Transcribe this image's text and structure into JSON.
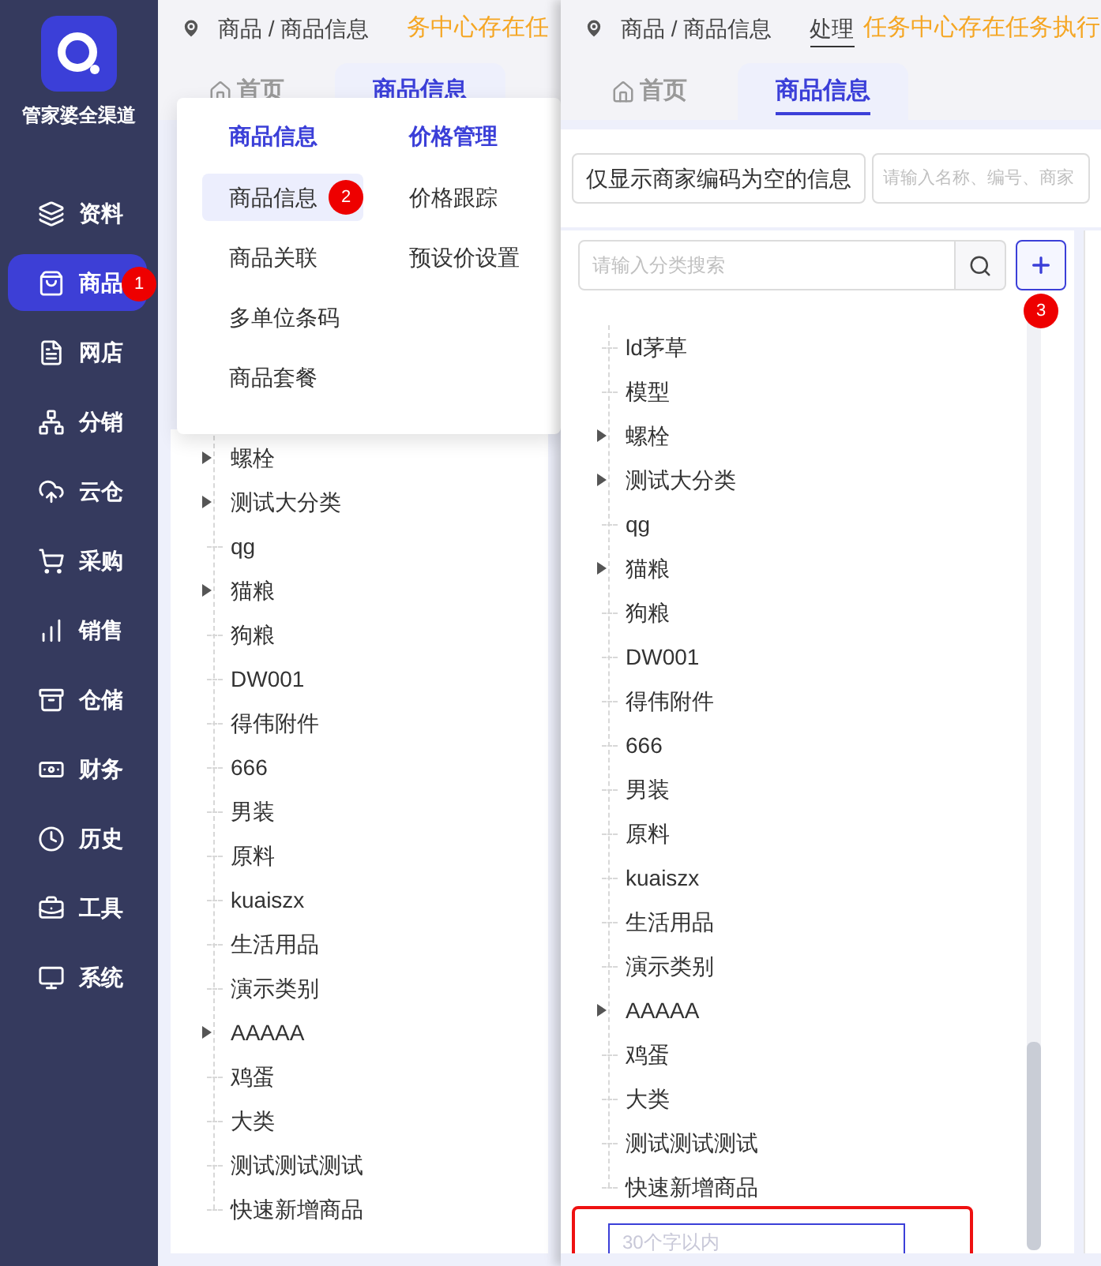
{
  "sidebar": {
    "brand": "管家婆全渠道",
    "items": [
      {
        "label": "资料",
        "selected": false
      },
      {
        "label": "商品",
        "selected": true,
        "badge": "1"
      },
      {
        "label": "网店",
        "selected": false
      },
      {
        "label": "分销",
        "selected": false
      },
      {
        "label": "云仓",
        "selected": false
      },
      {
        "label": "采购",
        "selected": false
      },
      {
        "label": "销售",
        "selected": false
      },
      {
        "label": "仓储",
        "selected": false
      },
      {
        "label": "财务",
        "selected": false
      },
      {
        "label": "历史",
        "selected": false
      },
      {
        "label": "工具",
        "selected": false
      },
      {
        "label": "系统",
        "selected": false
      }
    ]
  },
  "left_panel": {
    "breadcrumb": "商品 / 商品信息",
    "notice": "务中心存在任",
    "tabs": [
      {
        "label": "首页",
        "selected": false
      },
      {
        "label": "商品信息",
        "selected": true
      }
    ],
    "tree": [
      {
        "label": "螺栓",
        "expandable": true
      },
      {
        "label": "测试大分类",
        "expandable": true
      },
      {
        "label": "qg",
        "expandable": false
      },
      {
        "label": "猫粮",
        "expandable": true
      },
      {
        "label": "狗粮",
        "expandable": false
      },
      {
        "label": "DW001",
        "expandable": false
      },
      {
        "label": "得伟附件",
        "expandable": false
      },
      {
        "label": "666",
        "expandable": false
      },
      {
        "label": "男装",
        "expandable": false
      },
      {
        "label": "原料",
        "expandable": false
      },
      {
        "label": "kuaiszx",
        "expandable": false
      },
      {
        "label": "生活用品",
        "expandable": false
      },
      {
        "label": "演示类别",
        "expandable": false
      },
      {
        "label": "AAAAA",
        "expandable": true
      },
      {
        "label": "鸡蛋",
        "expandable": false
      },
      {
        "label": "大类",
        "expandable": false
      },
      {
        "label": "测试测试测试",
        "expandable": false
      },
      {
        "label": "快速新增商品",
        "expandable": false
      }
    ]
  },
  "menu": {
    "groups": [
      {
        "title": "商品信息",
        "items": [
          {
            "label": "商品信息",
            "selected": true,
            "badge": "2"
          },
          {
            "label": "商品关联",
            "selected": false
          },
          {
            "label": "多单位条码",
            "selected": false
          },
          {
            "label": "商品套餐",
            "selected": false
          }
        ]
      },
      {
        "title": "价格管理",
        "items": [
          {
            "label": "价格跟踪",
            "selected": false
          },
          {
            "label": "预设价设置",
            "selected": false
          }
        ]
      }
    ]
  },
  "right_panel": {
    "breadcrumb": "商品 / 商品信息",
    "link": "处理",
    "notice": "任务中心存在任务执行",
    "tabs": [
      {
        "label": "首页",
        "selected": false
      },
      {
        "label": "商品信息",
        "selected": true
      }
    ],
    "filter_button": "仅显示商家编码为空的信息",
    "search": {
      "placeholder": "请输入名称、编号、商家"
    },
    "category_search": {
      "placeholder": "请输入分类搜索"
    },
    "add_badge": "3",
    "tree": [
      {
        "label": "ld茅草",
        "expandable": false
      },
      {
        "label": "模型",
        "expandable": false
      },
      {
        "label": "螺栓",
        "expandable": true
      },
      {
        "label": "测试大分类",
        "expandable": true
      },
      {
        "label": "qg",
        "expandable": false
      },
      {
        "label": "猫粮",
        "expandable": true
      },
      {
        "label": "狗粮",
        "expandable": false
      },
      {
        "label": "DW001",
        "expandable": false
      },
      {
        "label": "得伟附件",
        "expandable": false
      },
      {
        "label": "666",
        "expandable": false
      },
      {
        "label": "男装",
        "expandable": false
      },
      {
        "label": "原料",
        "expandable": false
      },
      {
        "label": "kuaiszx",
        "expandable": false
      },
      {
        "label": "生活用品",
        "expandable": false
      },
      {
        "label": "演示类别",
        "expandable": false
      },
      {
        "label": "AAAAA",
        "expandable": true
      },
      {
        "label": "鸡蛋",
        "expandable": false
      },
      {
        "label": "大类",
        "expandable": false
      },
      {
        "label": "测试测试测试",
        "expandable": false
      },
      {
        "label": "快速新增商品",
        "expandable": false
      }
    ],
    "new_category": {
      "placeholder": "30个字以内"
    }
  }
}
